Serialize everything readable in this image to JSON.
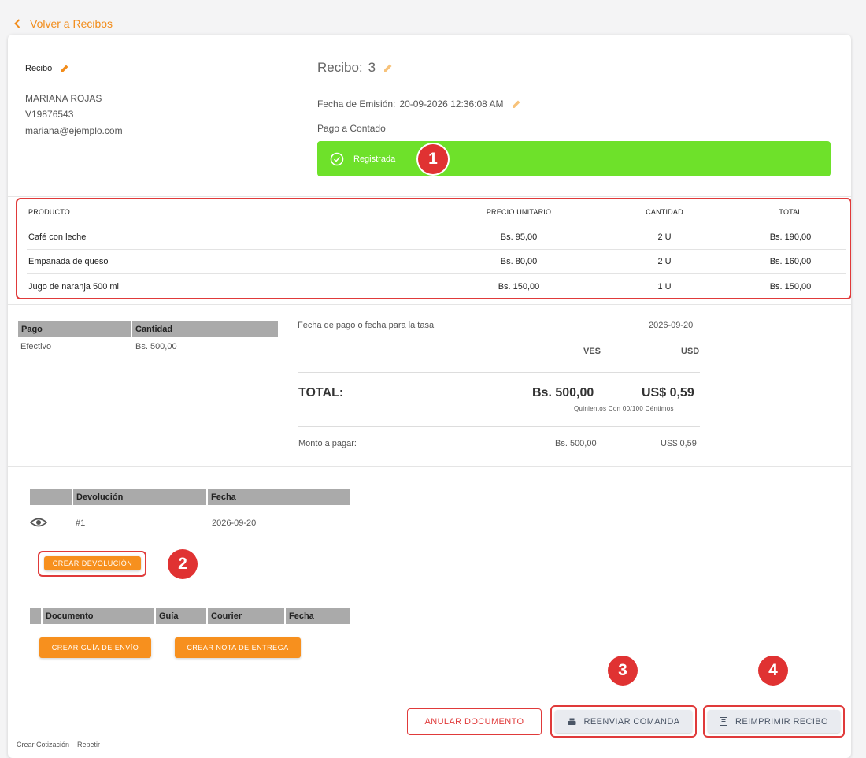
{
  "nav": {
    "back_label": "Volver a Recibos"
  },
  "customer": {
    "section_label": "Recibo",
    "name": "MARIANA ROJAS",
    "id_number": "V19876543",
    "email": "mariana@ejemplo.com"
  },
  "receipt": {
    "title": "Recibo:",
    "number": "3",
    "date_label": "Fecha de Emisión:",
    "date_value": "20-09-2026 12:36:08 AM",
    "payment_type": "Pago a Contado",
    "status": "Registrada",
    "status_color": "#6ee12a"
  },
  "products": {
    "headers": [
      "PRODUCTO",
      "PRECIO UNITARIO",
      "CANTIDAD",
      "TOTAL"
    ],
    "rows": [
      [
        "Café con leche",
        "Bs. 95,00",
        "2 U",
        "Bs. 190,00"
      ],
      [
        "Empanada de queso",
        "Bs. 80,00",
        "2 U",
        "Bs. 160,00"
      ],
      [
        "Jugo de naranja 500 ml",
        "Bs. 150,00",
        "1 U",
        "Bs. 150,00"
      ]
    ]
  },
  "payments": {
    "headers": [
      "Pago",
      "Cantidad"
    ],
    "rows": [
      [
        "Efectivo",
        "Bs. 500,00"
      ]
    ]
  },
  "totals": {
    "rate_date_label": "Fecha de pago o fecha para la tasa",
    "rate_date_value": "2026-09-20",
    "currency_1": "VES",
    "currency_2": "USD",
    "total_label": "TOTAL:",
    "total_ves": "Bs. 500,00",
    "total_usd": "US$ 0,59",
    "total_words": "Quinientos Con 00/100 Céntimos",
    "amount_label": "Monto a pagar:",
    "amount_ves": "Bs. 500,00",
    "amount_usd": "US$ 0,59"
  },
  "returns": {
    "headers": [
      "Devolución",
      "Fecha"
    ],
    "rows": [
      [
        "#1",
        "2026-09-20"
      ]
    ],
    "create_label": "CREAR DEVOLUCIÓN"
  },
  "shipping": {
    "headers": [
      "Documento",
      "Guía",
      "Courier",
      "Fecha"
    ],
    "create_guide_label": "CREAR GUÍA DE ENVÍO",
    "create_note_label": "CREAR NOTA DE ENTREGA"
  },
  "actions": {
    "void_label": "ANULAR DOCUMENTO",
    "resend_label": "REENVIAR COMANDA",
    "reprint_label": "REIMPRIMIR RECIBO"
  },
  "footer": {
    "quote_label": "Crear Cotización",
    "repeat_label": "Repetir"
  },
  "annotations": [
    "1",
    "2",
    "3",
    "4"
  ],
  "colors": {
    "accent": "#f7901e",
    "highlight": "#e03a3a",
    "status": "#6ee12a"
  }
}
